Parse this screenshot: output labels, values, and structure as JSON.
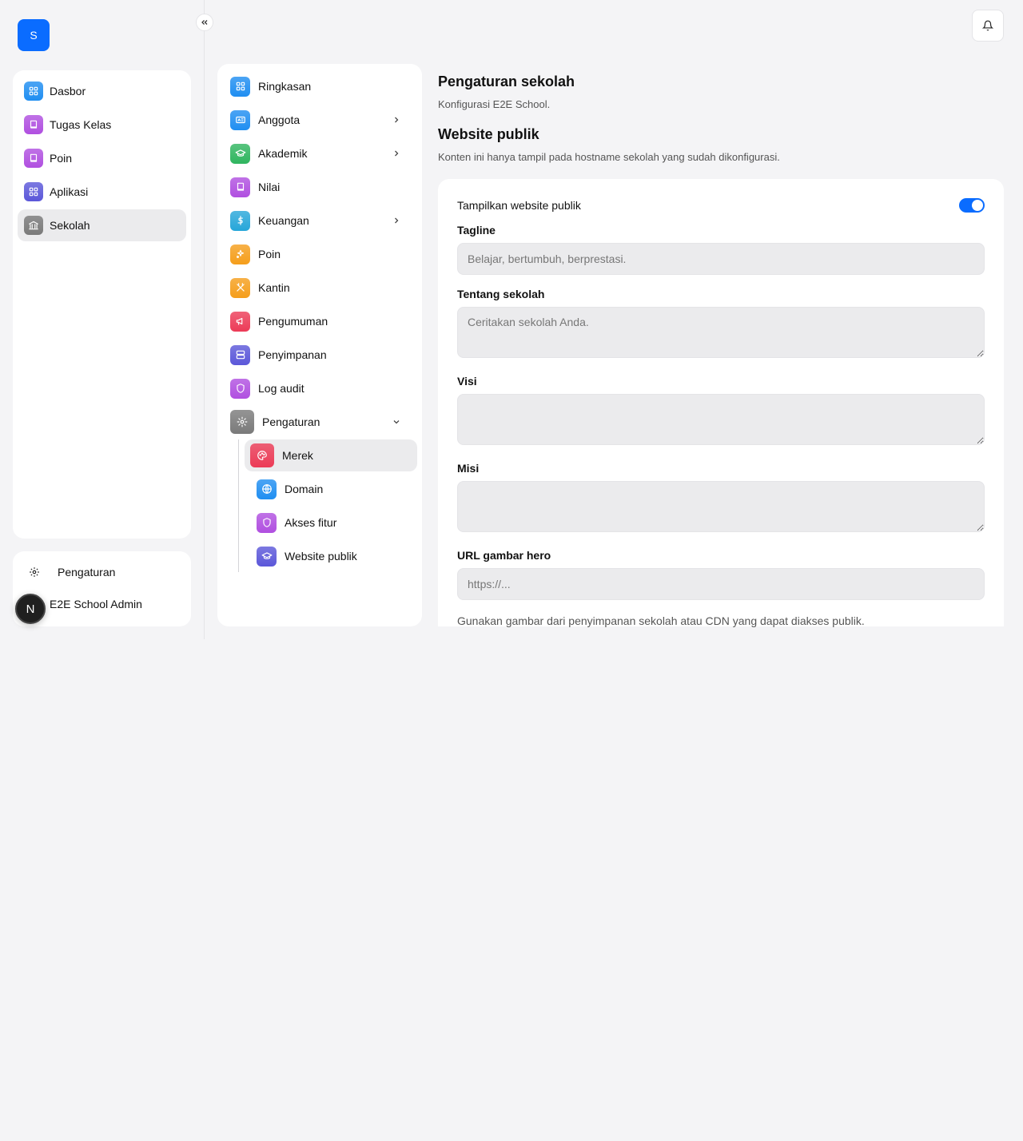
{
  "app": {
    "logo_letter": "S"
  },
  "sidebar": {
    "items": [
      {
        "label": "Dasbor",
        "icon": "grid-icon",
        "color": "#1f8ef1"
      },
      {
        "label": "Tugas Kelas",
        "icon": "book-icon",
        "color": "#b04fe0"
      },
      {
        "label": "Poin",
        "icon": "book-icon",
        "color": "#b04fe0"
      },
      {
        "label": "Aplikasi",
        "icon": "grid-icon",
        "color": "#5b57d9"
      },
      {
        "label": "Sekolah",
        "icon": "bank-icon",
        "color": "#7a7a7a",
        "active": true
      }
    ],
    "settings_label": "Pengaturan",
    "user_name": "E2E School Admin",
    "user_initial": "N"
  },
  "settings_nav": {
    "items": [
      {
        "label": "Ringkasan",
        "icon": "grid-icon",
        "color": "#1f8ef1"
      },
      {
        "label": "Anggota",
        "icon": "id-card-icon",
        "color": "#1f8ef1",
        "chevron": true
      },
      {
        "label": "Akademik",
        "icon": "graduation-cap-icon",
        "color": "#2fb55f",
        "chevron": true
      },
      {
        "label": "Nilai",
        "icon": "book-icon",
        "color": "#b04fe0"
      },
      {
        "label": "Keuangan",
        "icon": "dollar-icon",
        "color": "#26a6d9",
        "chevron": true
      },
      {
        "label": "Poin",
        "icon": "sparkle-icon",
        "color": "#f59e1b"
      },
      {
        "label": "Kantin",
        "icon": "utensils-icon",
        "color": "#f59e1b"
      },
      {
        "label": "Pengumuman",
        "icon": "megaphone-icon",
        "color": "#ec3b57"
      },
      {
        "label": "Penyimpanan",
        "icon": "server-icon",
        "color": "#5b57d9"
      },
      {
        "label": "Log audit",
        "icon": "shield-icon",
        "color": "#b04fe0"
      },
      {
        "label": "Pengaturan",
        "icon": "gear-icon",
        "color": "#7a7a7a",
        "expanded": true
      }
    ],
    "sub_items": [
      {
        "label": "Merek",
        "icon": "palette-icon",
        "color": "#ec3b57",
        "active": true
      },
      {
        "label": "Domain",
        "icon": "globe-icon",
        "color": "#1f8ef1"
      },
      {
        "label": "Akses fitur",
        "icon": "shield-icon",
        "color": "#b04fe0"
      },
      {
        "label": "Website publik",
        "icon": "graduation-cap-icon",
        "color": "#5b57d9"
      }
    ]
  },
  "page": {
    "title": "Pengaturan sekolah",
    "subtitle": "Konfigurasi E2E School.",
    "section_title": "Website publik",
    "section_desc": "Konten ini hanya tampil pada hostname sekolah yang sudah dikonfigurasi."
  },
  "form": {
    "toggle_label": "Tampilkan website publik",
    "toggle_on": true,
    "tagline_label": "Tagline",
    "tagline_placeholder": "Belajar, bertumbuh, berprestasi.",
    "about_label": "Tentang sekolah",
    "about_placeholder": "Ceritakan sekolah Anda.",
    "vision_label": "Visi",
    "mission_label": "Misi",
    "hero_label": "URL gambar hero",
    "hero_placeholder": "https://...",
    "hint": "Gunakan gambar dari penyimpanan sekolah atau CDN yang dapat diakses publik."
  }
}
